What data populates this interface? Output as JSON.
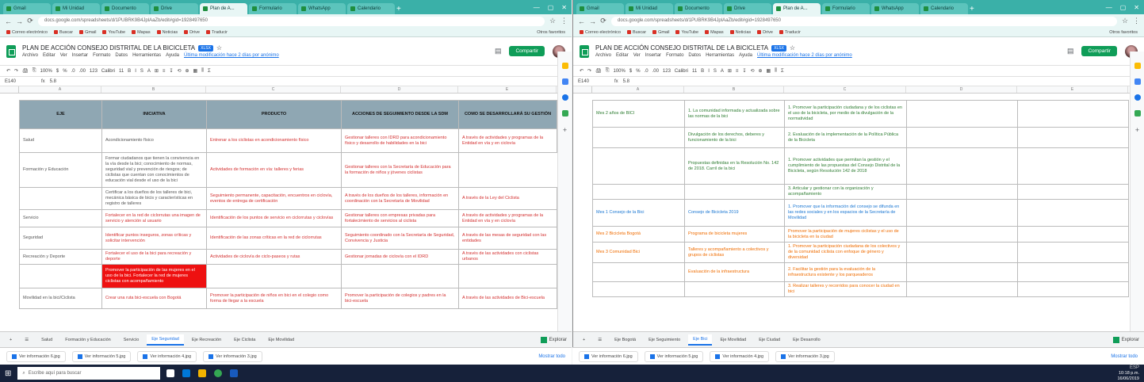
{
  "browser": {
    "tabs": [
      "Gmail",
      "Mi Unidad",
      "Documento",
      "Drive",
      "Plan de A...",
      "Formulario",
      "WhatsApp",
      "Calendario"
    ],
    "active_tab": 4,
    "url": "docs.google.com/spreadsheets/d/1PUBRK9B4JplAaZb/edit#gid=1928497650",
    "bookmarks": [
      "Correo electrónico",
      "Buscar",
      "Gmail",
      "YouTube",
      "Mapas",
      "Noticias",
      "Drive",
      "Traducir"
    ],
    "other_bookmarks": "Otros favoritos"
  },
  "sheet": {
    "title": "PLAN DE ACCIÓN CONSEJO DISTRITAL DE LA BICICLETA",
    "badge": "XLSX",
    "menus": [
      "Archivo",
      "Editar",
      "Ver",
      "Insertar",
      "Formato",
      "Datos",
      "Herramientas",
      "Ayuda"
    ],
    "last_edit": "Última modificación hace 2 días por anónimo",
    "share": "Compartir",
    "toolbar": [
      "↶",
      "↷",
      "🖨",
      "⎘",
      "100%",
      "$",
      "%",
      ".0",
      ".00",
      "123",
      "Calibri",
      "11",
      "B",
      "I",
      "S",
      "A",
      "⊞",
      "≡",
      "↧",
      "⟲",
      "⊕",
      "▦",
      "⫼",
      "Σ"
    ],
    "cell_ref": "E140",
    "formula_value": "5.8"
  },
  "left": {
    "columns": [
      "A",
      "B",
      "C",
      "D",
      "E",
      "F"
    ],
    "headers": [
      "EJE",
      "INICIATIVA",
      "PRODUCTO",
      "ACCIONES DE SEGUIMIENTO DESDE LA SDM",
      "COMO SE DESARROLLARÁ SU GESTIÓN"
    ],
    "rows": [
      {
        "n": "3",
        "cells": [
          "Salud",
          "Acondicionamiento físico",
          "Entrenar a los ciclistas en acondicionamiento físico",
          "Gestionar talleres con IDRD para acondicionamiento físico y desarrollo de habilidades en la bici",
          "A través de actividades y programas de la Entidad en vía y en ciclovía"
        ]
      },
      {
        "n": "4",
        "cells": [
          "Formación y Educación",
          "Formar ciudadanos que tienen la convivencia en la vía desde la bici; conocimiento de normas, seguridad vial y prevención de riesgos; de ciclistas que cuentan con conocimientos de educación vial desde el uso de la bici",
          "Actividades de formación en vía: talleres y ferias",
          "Gestionar talleres con la Secretaría de Educación para la formación de niños y jóvenes ciclistas"
        ]
      },
      {
        "n": "5",
        "cells": [
          "",
          "Certificar a los dueños de los talleres de bici, mecánica básica de bicis y características en registro de talleres",
          "Seguimiento permanente, capacitación, encuentros en ciclovía, eventos de entrega de certificación",
          "A través de los dueños de los talleres, información en coordinación con la Secretaría de Movilidad",
          "A través de la Ley del Ciclista"
        ]
      },
      {
        "n": "6",
        "cells": [
          "Servicio",
          "Fortalecer en la red de ciclorrutas una imagen de servicio y atención al usuario",
          "Identificación de los puntos de servicio en ciclorrutas y ciclovías",
          "Gestionar talleres con empresas privadas para fortalecimiento de servicios al ciclista",
          "A través de actividades y programas de la Entidad en vía y en ciclovía"
        ]
      },
      {
        "n": "7",
        "cells": [
          "Seguridad",
          "Identificar puntos inseguros, zonas críticas y solicitar intervención",
          "Identificación de las zonas críticas en la red de ciclorrutas",
          "Seguimiento coordinado con la Secretaría de Seguridad, Convivencia y Justicia",
          "A través de las mesas de seguridad con las entidades"
        ]
      },
      {
        "n": "8",
        "cells": [
          "Recreación y Deporte",
          "Fortalecer el uso de la bici para recreación y deporte",
          "Actividades de ciclovía de ciclo-paseos y rutas",
          "Gestionar jornadas de ciclovía con el IDRD",
          "A través de las actividades con ciclistas urbanos"
        ]
      },
      {
        "n": "9",
        "cells": [
          "",
          "Promover la participación de las mujeres en el uso de la bici. Fortalecer la red de mujeres ciclistas con acompañamiento",
          "",
          "",
          ""
        ]
      },
      {
        "n": "10",
        "cells": [
          "Movilidad en la bici/Ciclista",
          "Crear una ruta bici-escuela con Bogotá",
          "Promover la participación de niños en bici en el colegio como forma de llegar a la escuela",
          "Promover la participación de colegios y padres en la bici-escuela",
          "A través de las actividades de Bici-escuela"
        ]
      }
    ],
    "tabs": [
      "+",
      "☰",
      "Salud",
      "Formación y Educación",
      "Servicio",
      "Eje Seguridad",
      "Eje Recreación",
      "Eje Ciclista",
      "Eje Movilidad"
    ],
    "active_tab": 5,
    "explore": "Explorar"
  },
  "right": {
    "columns": [
      "A",
      "B",
      "C",
      "D",
      "E",
      "F"
    ],
    "rows": [
      {
        "n": "3",
        "cells": [
          "Mes 2 años de BICI",
          "1. La comunidad informada y actualizada sobre las normas de la bici",
          "1. Promover la participación ciudadana y de los ciclistas en el uso de la bicicleta, por medio de la divulgación de la normatividad",
          "",
          ""
        ],
        "cls": [
          "grn",
          "grn",
          "grn",
          "",
          ""
        ]
      },
      {
        "n": "4",
        "cells": [
          "",
          "Divulgación de los derechos, deberes y funcionamiento de la bici",
          "2. Evaluación de la implementación de la Política Pública de la Bicicleta",
          "",
          ""
        ],
        "cls": [
          "grn",
          "grn",
          "grn",
          "",
          ""
        ]
      },
      {
        "n": "5",
        "cells": [
          "",
          "Propuestas definidas en la Resolución No. 142 de 2018. Carril de la bici",
          "1. Promover actividades que permitan la gestión y el cumplimiento de las propuestas del Consejo Distrital de la Bicicleta, según Resolución 142 de 2018",
          "",
          ""
        ],
        "cls": [
          "grn",
          "grn",
          "grn",
          "",
          ""
        ]
      },
      {
        "n": "6",
        "cells": [
          "",
          "",
          "3. Articular y gestionar con la organización y acompañamiento",
          "",
          ""
        ],
        "cls": [
          "grn",
          "grn",
          "grn",
          "",
          ""
        ]
      },
      {
        "n": "7",
        "cells": [
          "Mes 1 Consejo de la Bici",
          "Consejo de Bicicleta 2019",
          "1. Promover que la información del consejo se difunda en las redes sociales y en los espacios de la Secretaría de Movilidad",
          "",
          ""
        ],
        "cls": [
          "blu",
          "blu",
          "blu",
          "",
          ""
        ]
      },
      {
        "n": "8",
        "cells": [
          "Mes 2 Bicicleta Bogotá",
          "Programa de bicicleta mujeres",
          "Promover la participación de mujeres ciclistas y el uso de la bicicleta en la ciudad",
          "",
          ""
        ],
        "cls": [
          "org",
          "org",
          "org",
          "",
          ""
        ]
      },
      {
        "n": "9",
        "cells": [
          "Mes 3 Comunidad Bici",
          "Talleres y acompañamiento a colectivos y grupos de ciclistas",
          "1. Promover la participación ciudadana de los colectivos y de la comunidad ciclista con enfoque de género y diversidad",
          "",
          ""
        ],
        "cls": [
          "org",
          "org",
          "org",
          "",
          ""
        ]
      },
      {
        "n": "10",
        "cells": [
          "",
          "Evaluación de la infraestructura",
          "2. Facilitar la gestión para la evaluación de la infraestructura existente y los parqueaderos",
          "",
          ""
        ],
        "cls": [
          "org",
          "org",
          "org",
          "",
          ""
        ]
      },
      {
        "n": "11",
        "cells": [
          "",
          "",
          "3. Realizar talleres y recorridos para conocer la ciudad en bici",
          "",
          ""
        ],
        "cls": [
          "org",
          "org",
          "org",
          "",
          ""
        ]
      }
    ],
    "tabs": [
      "+",
      "☰",
      "Eje Bogotá",
      "Eje Seguimiento",
      "Eje Bici",
      "Eje Movilidad",
      "Eje Ciudad",
      "Eje Desarrollo"
    ],
    "active_tab": 4,
    "explore": "Explorar"
  },
  "downloads": [
    "Ver información 6.jpg",
    "Ver información 5.jpg",
    "Ver información 4.jpg",
    "Ver información 3.jpg"
  ],
  "show_all": "Mostrar todo",
  "taskbar": {
    "search_placeholder": "Escribe aquí para buscar",
    "time": "10:18 p.m.",
    "date": "16/06/2019",
    "lang": "ESP"
  }
}
